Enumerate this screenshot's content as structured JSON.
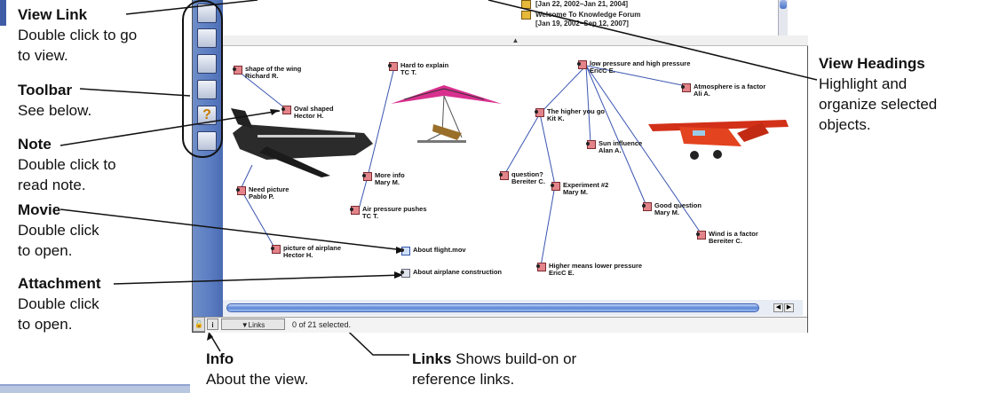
{
  "callouts": {
    "view_link": {
      "title": "View Link",
      "desc1": "Double click to go",
      "desc2": "to view."
    },
    "toolbar": {
      "title": "Toolbar",
      "desc1": "See below."
    },
    "note": {
      "title": "Note",
      "desc1": "Double click to",
      "desc2": "read note."
    },
    "movie": {
      "title": "Movie",
      "desc1": "Double click",
      "desc2": "to open."
    },
    "attachment": {
      "title": "Attachment",
      "desc1": "Double click",
      "desc2": "to open."
    },
    "view_headings": {
      "title": "View Headings",
      "desc1": "Highlight and",
      "desc2": "organize selected",
      "desc3": "objects."
    },
    "info": {
      "title": "Info",
      "desc1": "About the view."
    },
    "links": {
      "title": "Links",
      "desc_inline": "Shows build-on or",
      "desc2": "reference links."
    }
  },
  "view_list": [
    {
      "date": "[Jan 22, 2002–Jan 21, 2004]"
    },
    {
      "title": "Welcome To Knowledge Forum",
      "date": "[Jan 19, 2002–Sep 12, 2007]"
    }
  ],
  "notes": [
    {
      "title": "shape of the wing",
      "author": "Richard R."
    },
    {
      "title": "Oval shaped",
      "author": "Hector H."
    },
    {
      "title": "Hard to explain",
      "author": "TC T."
    },
    {
      "title": "low pressure and high pressure",
      "author": "EricC E."
    },
    {
      "title": "Atmosphere is a factor",
      "author": "Ali A."
    },
    {
      "title": "The higher you go",
      "author": "Kit K."
    },
    {
      "title": "Sun influence",
      "author": "Alan A."
    },
    {
      "title": "More info",
      "author": "Mary M."
    },
    {
      "title": "question?",
      "author": "Bereiter C."
    },
    {
      "title": "Experiment #2",
      "author": "Mary M."
    },
    {
      "title": "Good question",
      "author": "Mary M."
    },
    {
      "title": "Need picture",
      "author": "Pablo P."
    },
    {
      "title": "Air pressure pushes",
      "author": "TC T."
    },
    {
      "title": "Wind is a factor",
      "author": "Bereiter C."
    },
    {
      "title": "picture of airplane",
      "author": "Hector H."
    },
    {
      "title": "Higher means lower pressure",
      "author": "EricC E."
    }
  ],
  "movie": {
    "label": "About flight.mov"
  },
  "attachment": {
    "label": "About airplane construction"
  },
  "status": {
    "links_label": "▼Links",
    "selection": "0 of 21 selected.",
    "info_glyph": "i"
  },
  "splitter_glyph": "▲",
  "colors": {
    "sidebar": "#5a7cc1",
    "note_icon": "#e3848a",
    "scrollbar": "#5a86d6"
  }
}
